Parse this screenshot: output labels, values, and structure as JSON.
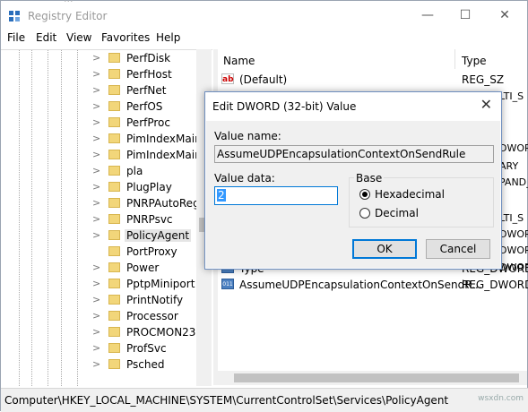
{
  "window": {
    "title": "Registry Editor",
    "ghost_text": "...",
    "minimize": "—",
    "maximize": "☐",
    "close": "✕"
  },
  "menu": [
    "File",
    "Edit",
    "View",
    "Favorites",
    "Help"
  ],
  "tree": {
    "items": [
      {
        "label": "PerfDisk"
      },
      {
        "label": "PerfHost"
      },
      {
        "label": "PerfNet"
      },
      {
        "label": "PerfOS"
      },
      {
        "label": "PerfProc"
      },
      {
        "label": "PimIndexMaint"
      },
      {
        "label": "PimIndexMaint"
      },
      {
        "label": "pla"
      },
      {
        "label": "PlugPlay"
      },
      {
        "label": "PNRPAutoReg"
      },
      {
        "label": "PNRPsvc"
      },
      {
        "label": "PolicyAgent",
        "selected": true
      },
      {
        "label": "PortProxy"
      },
      {
        "label": "Power"
      },
      {
        "label": "PptpMiniport"
      },
      {
        "label": "PrintNotify"
      },
      {
        "label": "Processor"
      },
      {
        "label": "PROCMON23"
      },
      {
        "label": "ProfSvc"
      },
      {
        "label": "Psched"
      }
    ]
  },
  "list": {
    "headers": {
      "name": "Name",
      "type": "Type"
    },
    "rows": [
      {
        "name": "(Default)",
        "type": "REG_SZ",
        "icon": "string-value-icon"
      },
      {
        "name": "Type",
        "type": "REG_DWORD",
        "icon": "dword-value-icon"
      },
      {
        "name": "AssumeUDPEncapsulationContextOnSendR...",
        "type": "REG_DWORD",
        "icon": "dword-value-icon"
      }
    ],
    "partial_types": [
      "LTI_S",
      "DWORD",
      "ARY",
      "PAND_",
      "LTI_S",
      "DWORD",
      "DWORD",
      "DWORD"
    ]
  },
  "statusbar": {
    "path": "Computer\\HKEY_LOCAL_MACHINE\\SYSTEM\\CurrentControlSet\\Services\\PolicyAgent",
    "watermark": "wsxdn.com"
  },
  "dialog": {
    "title": "Edit DWORD (32-bit) Value",
    "close": "✕",
    "value_name_label": "Value name:",
    "value_name": "AssumeUDPEncapsulationContextOnSendRule",
    "value_data_label": "Value data:",
    "value_data": "2",
    "base_label": "Base",
    "base_options": [
      "Hexadecimal",
      "Decimal"
    ],
    "base_selected": "Hexadecimal",
    "ok_label": "OK",
    "cancel_label": "Cancel"
  }
}
